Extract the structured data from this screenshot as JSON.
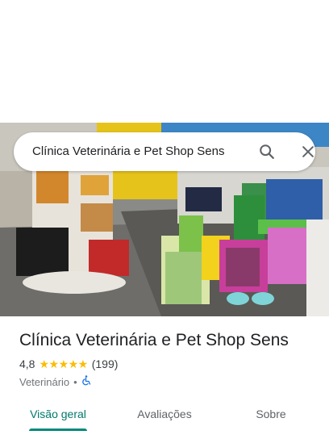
{
  "search": {
    "query": "Clínica Veterinária e Pet Shop Sens",
    "search_icon": "search-icon",
    "close_icon": "close-icon"
  },
  "hero_photo": {
    "description_icon": "storefront-photo"
  },
  "place": {
    "name": "Clínica Veterinária e Pet Shop Sens",
    "rating": "4,8",
    "stars": "★★★★★",
    "review_count": "(199)",
    "category": "Veterinário",
    "separator": "•",
    "accessibility_icon": "wheelchair-icon"
  },
  "tabs": [
    {
      "label": "Visão geral",
      "active": true
    },
    {
      "label": "Avaliações",
      "active": false
    },
    {
      "label": "Sobre",
      "active": false
    }
  ],
  "colors": {
    "accent": "#00796b",
    "star": "#fbbc04",
    "accessibility": "#1a73e8"
  }
}
